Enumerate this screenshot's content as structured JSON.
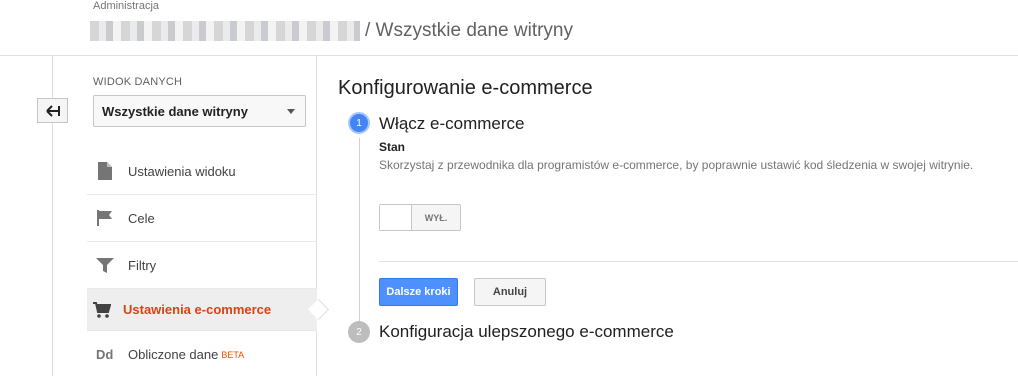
{
  "header": {
    "admin_label": "Administracja",
    "page_title": "/ Wszystkie dane witryny"
  },
  "sidebar": {
    "view_label": "WIDOK DANYCH",
    "view_selected": "Wszystkie dane witryny",
    "items": [
      {
        "label": "Ustawienia widoku",
        "icon": "document-icon"
      },
      {
        "label": "Cele",
        "icon": "flag-icon"
      },
      {
        "label": "Filtry",
        "icon": "filter-icon"
      },
      {
        "label": "Ustawienia e-commerce",
        "icon": "cart-icon",
        "active": true
      },
      {
        "label": "Obliczone dane",
        "icon": "dd-icon",
        "badge": "BETA",
        "icon_text": "Dd"
      }
    ]
  },
  "main": {
    "title": "Konfigurowanie e-commerce",
    "step1": {
      "number": "1",
      "title": "Włącz e-commerce",
      "status_label": "Stan",
      "description": "Skorzystaj z przewodnika dla programistów e-commerce, by poprawnie ustawić kod śledzenia w swojej witrynie.",
      "toggle_label": "WYŁ.",
      "toggle_on": false
    },
    "buttons": {
      "next": "Dalsze kroki",
      "cancel": "Anuluj"
    },
    "step2": {
      "number": "2",
      "title": "Konfiguracja ulepszonego e-commerce"
    }
  },
  "colors": {
    "accent_blue": "#4d90fe",
    "active_item": "#d84315",
    "step_active": "#4285f4",
    "step_inactive": "#bdbdbd"
  }
}
